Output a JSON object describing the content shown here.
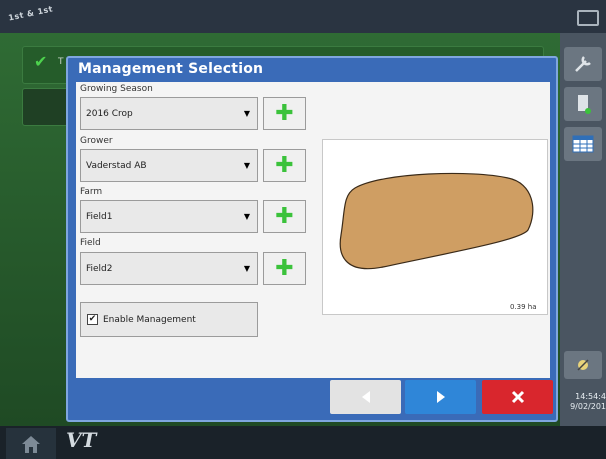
{
  "topbar": {
    "logo_text": "1st & 1st"
  },
  "background": {
    "row1_text": "T"
  },
  "sidebar": {
    "time": "14:54:4",
    "date": "9/02/201"
  },
  "dialog": {
    "title": "Management Selection",
    "growing_season": {
      "label": "Growing Season",
      "value": "2016 Crop"
    },
    "grower": {
      "label": "Grower",
      "value": "Vaderstad AB"
    },
    "farm": {
      "label": "Farm",
      "value": "Field1"
    },
    "field": {
      "label": "Field",
      "value": "Field2"
    },
    "enable_management": {
      "label": "Enable Management",
      "checked": true
    },
    "map": {
      "area": "0.39 ha"
    }
  },
  "footer": {
    "back_icon": "left-arrow-icon",
    "next_icon": "right-arrow-icon",
    "cancel_icon": "close-icon"
  },
  "bottombar": {
    "vt_label": "VT"
  },
  "colors": {
    "dialog_blue": "#3a6bb8",
    "next_blue": "#2f86d8",
    "cancel_red": "#d9262d",
    "plus_green": "#3bc23b",
    "field_fill": "#cf9e63"
  }
}
